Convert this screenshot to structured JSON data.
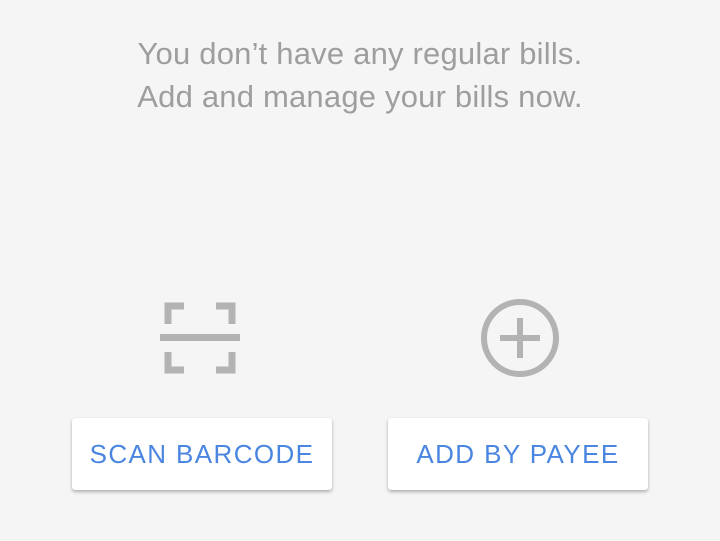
{
  "empty_state": {
    "line1": "You don’t have any regular bills.",
    "line2": "Add and manage your bills now."
  },
  "actions": {
    "scan": {
      "label": "SCAN BARCODE",
      "icon": "barcode-scan-icon"
    },
    "payee": {
      "label": "ADD BY PAYEE",
      "icon": "add-circle-icon"
    }
  },
  "colors": {
    "background": "#f5f5f5",
    "message_text": "#9e9e9e",
    "icon": "#b3b3b3",
    "button_text": "#4a86e0",
    "button_background": "#ffffff"
  }
}
